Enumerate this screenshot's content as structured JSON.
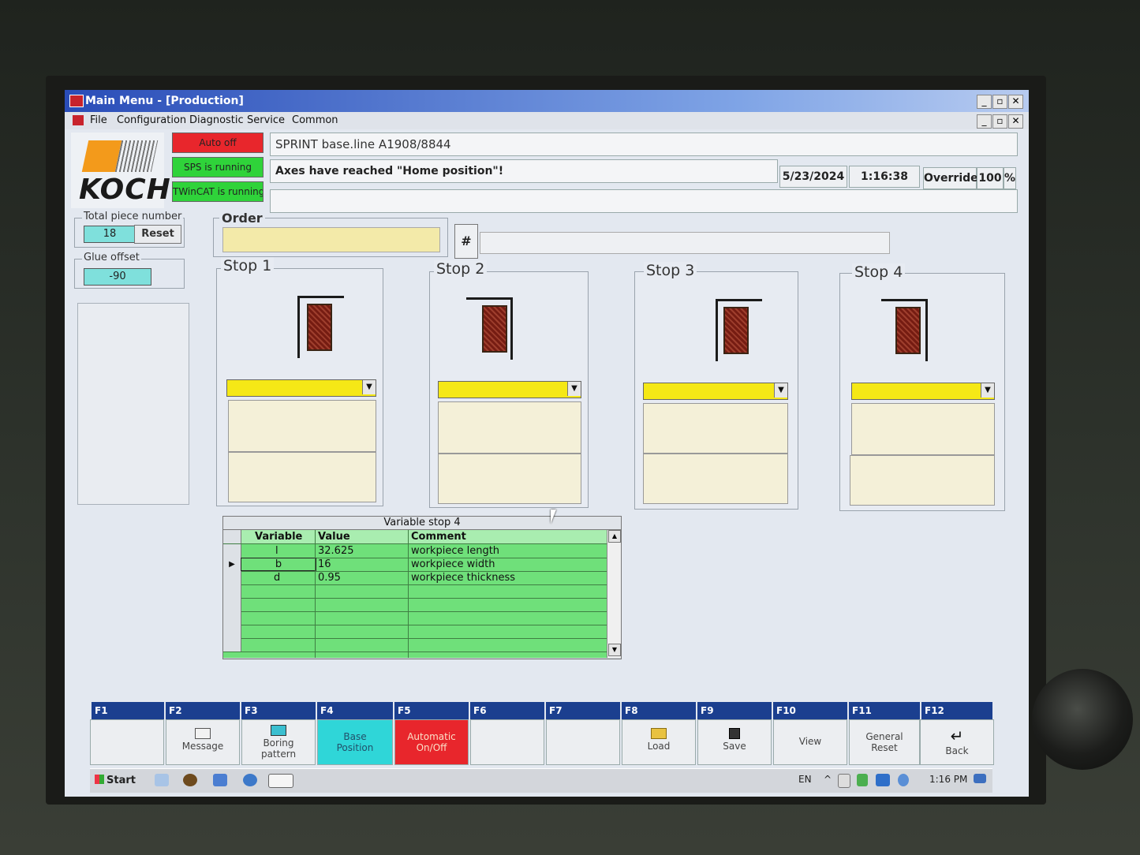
{
  "window": {
    "title": "Main Menu - [Production]",
    "controls": [
      "_",
      "▫",
      "✕"
    ]
  },
  "menu": [
    "File",
    "Configuration",
    "Diagnostic",
    "Service",
    "Common"
  ],
  "logo": {
    "text": "KOCH"
  },
  "status": {
    "auto_off": {
      "label": "Auto off",
      "color": "#e8262c"
    },
    "sps": {
      "label": "SPS is running",
      "color": "#2fd33a"
    },
    "twincat": {
      "label": "TWinCAT is running",
      "color": "#2fd33a"
    }
  },
  "header": {
    "machine": "SPRINT base.line A1908/8844",
    "message": "Axes have reached \"Home position\"!",
    "date": "5/23/2024",
    "time": "1:16:38 PM",
    "override_label": "Override",
    "override_value": "100",
    "override_unit": "%"
  },
  "left": {
    "total_piece_label": "Total piece number",
    "total_piece_value": "18",
    "reset_label": "Reset",
    "glue_offset_label": "Glue offset",
    "glue_offset_value": "-90"
  },
  "order": {
    "label": "Order",
    "value": "",
    "hash_label": "#",
    "hash_value": ""
  },
  "stops": [
    {
      "title": "Stop 1"
    },
    {
      "title": "Stop 2"
    },
    {
      "title": "Stop 3"
    },
    {
      "title": "Stop 4"
    }
  ],
  "variable_table": {
    "caption": "Variable stop 4",
    "headers": [
      "Variable",
      "Value",
      "Comment"
    ],
    "rows": [
      {
        "variable": "l",
        "value": "32.625",
        "comment": "workpiece length"
      },
      {
        "variable": "b",
        "value": "16",
        "comment": "workpiece width"
      },
      {
        "variable": "d",
        "value": "0.95",
        "comment": "workpiece thickness"
      }
    ]
  },
  "fkeys": [
    {
      "key": "F1",
      "label": ""
    },
    {
      "key": "F2",
      "label": "Message"
    },
    {
      "key": "F3",
      "label": "Boring pattern"
    },
    {
      "key": "F4",
      "label": "Base Position"
    },
    {
      "key": "F5",
      "label": "Automatic On/Off"
    },
    {
      "key": "F6",
      "label": ""
    },
    {
      "key": "F7",
      "label": ""
    },
    {
      "key": "F8",
      "label": "Load"
    },
    {
      "key": "F9",
      "label": "Save"
    },
    {
      "key": "F10",
      "label": "View"
    },
    {
      "key": "F11",
      "label": "General Reset"
    },
    {
      "key": "F12",
      "label": "Back"
    }
  ],
  "fkey_colors": {
    "F4": "#2fd6d8",
    "F5": "#e8262c"
  },
  "taskbar": {
    "start_label": "Start",
    "lang": "EN",
    "clock": "1:16 PM"
  }
}
